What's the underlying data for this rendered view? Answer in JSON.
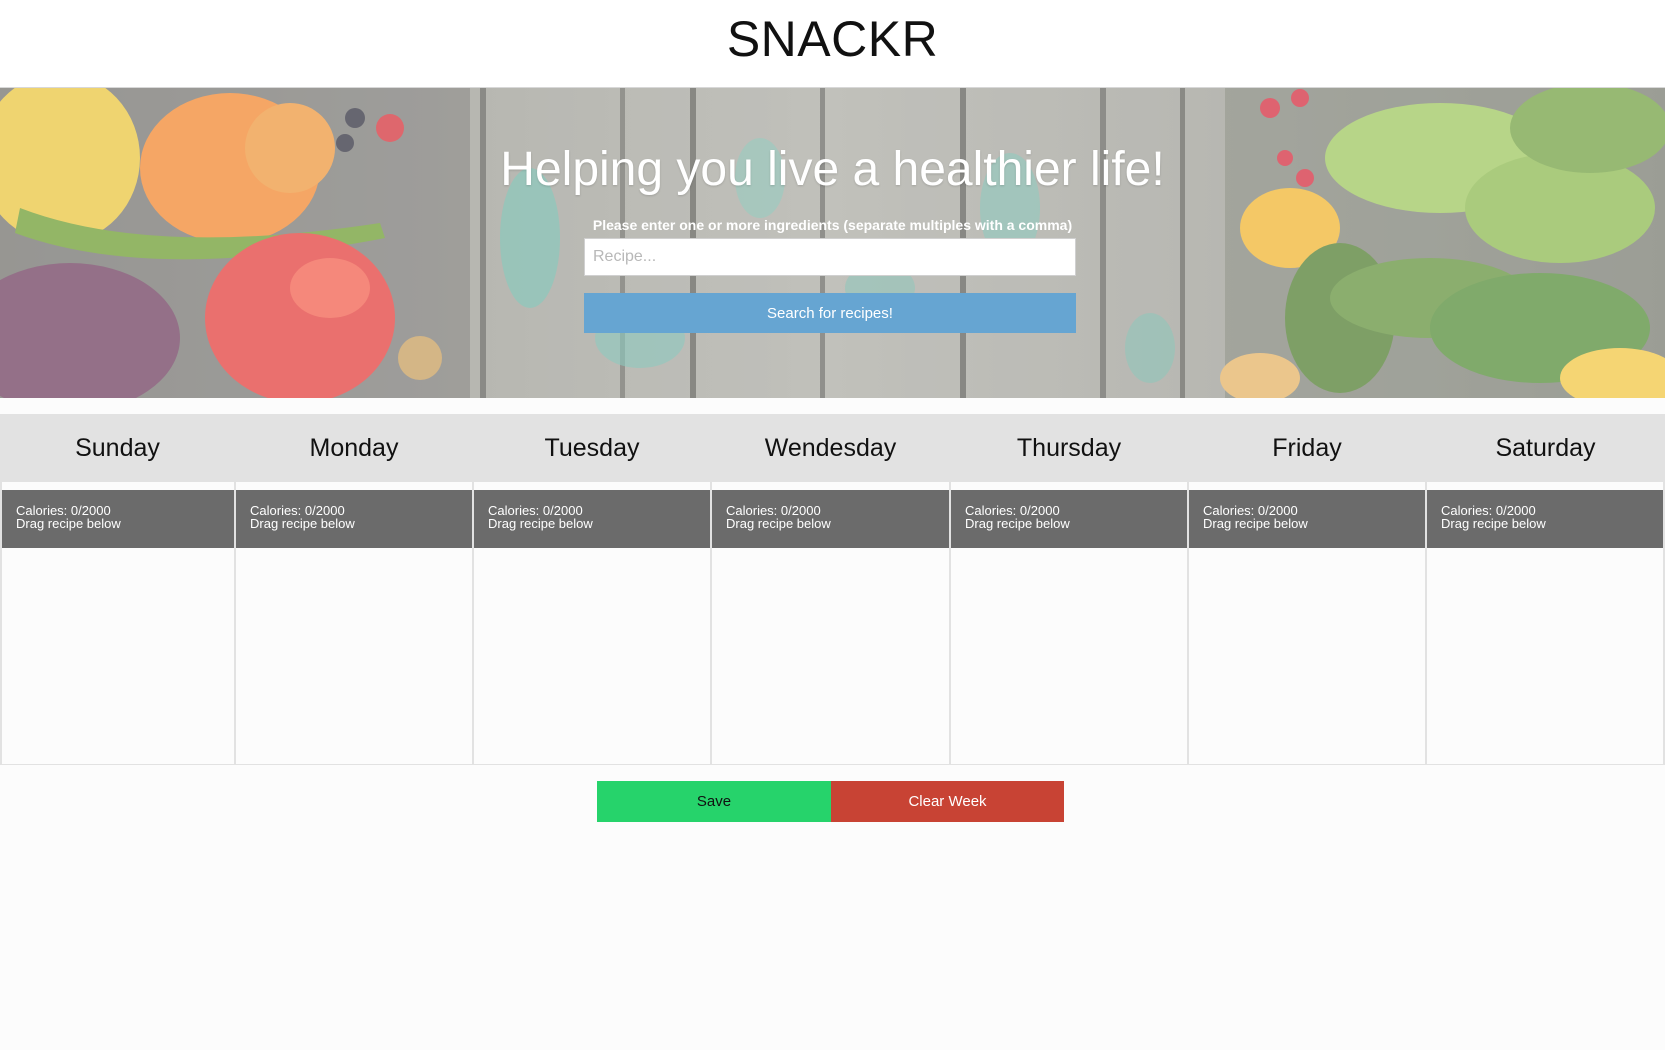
{
  "header": {
    "brand": "SNACKR"
  },
  "hero": {
    "title": "Helping you live a healthier life!",
    "instructions": "Please enter one or more ingredients (separate multiples with a comma)",
    "search": {
      "placeholder": "Recipe...",
      "value": ""
    },
    "search_button_label": "Search for recipes!"
  },
  "planner": {
    "days": [
      {
        "name": "Sunday",
        "calories_text": "Calories: 0/2000",
        "hint": "Drag recipe below"
      },
      {
        "name": "Monday",
        "calories_text": "Calories: 0/2000",
        "hint": "Drag recipe below"
      },
      {
        "name": "Tuesday",
        "calories_text": "Calories: 0/2000",
        "hint": "Drag recipe below"
      },
      {
        "name": "Wendesday",
        "calories_text": "Calories: 0/2000",
        "hint": "Drag recipe below"
      },
      {
        "name": "Thursday",
        "calories_text": "Calories: 0/2000",
        "hint": "Drag recipe below"
      },
      {
        "name": "Friday",
        "calories_text": "Calories: 0/2000",
        "hint": "Drag recipe below"
      },
      {
        "name": "Saturday",
        "calories_text": "Calories: 0/2000",
        "hint": "Drag recipe below"
      }
    ]
  },
  "actions": {
    "save_label": "Save",
    "clear_label": "Clear Week"
  },
  "colors": {
    "search_button": "#66a5d2",
    "save_button": "#26d36b",
    "clear_button": "#c84334",
    "calorie_box": "#6b6b6b",
    "day_header_bar": "#e2e2e2"
  }
}
